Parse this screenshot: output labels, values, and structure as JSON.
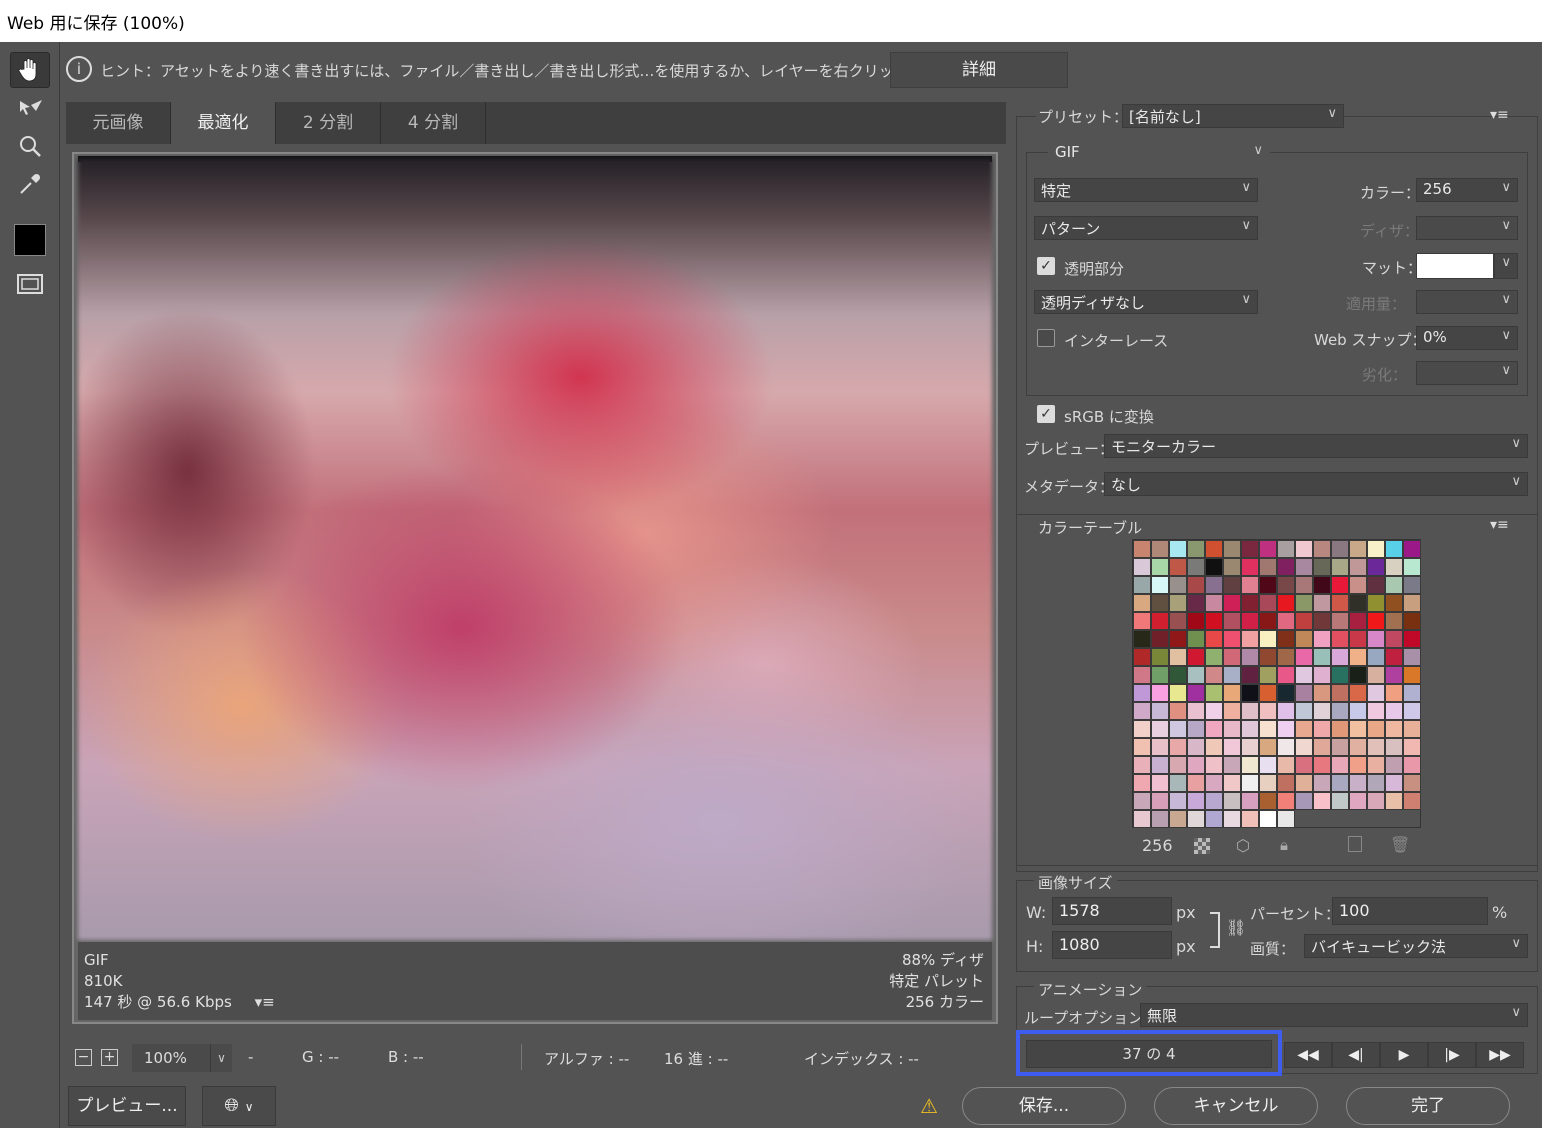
{
  "window": {
    "title": "Web 用に保存 (100%)"
  },
  "hint": {
    "text": "ヒント：アセットをより速く書き出すには、ファイル／書き出し／書き出し形式…を使用するか、レイヤーを右クリックして使用。",
    "detail_button": "詳細"
  },
  "tabs": [
    {
      "label": "元画像"
    },
    {
      "label": "最適化"
    },
    {
      "label": "2 分割"
    },
    {
      "label": "4 分割"
    }
  ],
  "image_info": {
    "format": "GIF",
    "size": "810K",
    "download_time": "147 秒 @ 56.6 Kbps",
    "dither": "88% ディザ",
    "palette": "特定 パレット",
    "colors": "256 カラー"
  },
  "statusbar": {
    "zoom": "100%",
    "r": "-",
    "g": "G : --",
    "b": "B : --",
    "alpha": "アルファ : --",
    "hex": "16 進 : --",
    "index": "インデックス : --"
  },
  "preset": {
    "label": "プリセット：",
    "value": "[名前なし]",
    "format": "GIF",
    "reduction": "特定",
    "dither_algo": "パターン",
    "colors_label": "カラー：",
    "colors_value": "256",
    "dither_label": "ディザ：",
    "transparency_label": "透明部分",
    "matte_label": "マット：",
    "transparency_dither": "透明ディザなし",
    "amount_label": "適用量：",
    "interlace_label": "インターレース",
    "websnap_label": "Web スナップ：",
    "websnap_value": "0%",
    "lossy_label": "劣化：",
    "srgb_label": "sRGB に変換",
    "preview_label": "プレビュー：",
    "preview_value": "モニターカラー",
    "metadata_label": "メタデータ：",
    "metadata_value": "なし"
  },
  "color_table": {
    "title": "カラーテーブル",
    "count": "256",
    "swatches": [
      "#c98470",
      "#b08878",
      "#a8e8f0",
      "#8a9870",
      "#d05030",
      "#9a8870",
      "#7a2840",
      "#c03080",
      "#a8a0a0",
      "#f0c8d0",
      "#b88880",
      "#8a7880",
      "#c8a888",
      "#f8f0c8",
      "#58d0e8",
      "#9a1888",
      "#d8c8d8",
      "#a8d8a8",
      "#c05848",
      "#7a7a78",
      "#101010",
      "#9a8870",
      "#e03060",
      "#a07870",
      "#802060",
      "#a888a0",
      "#686858",
      "#a8a888",
      "#c09898",
      "#6a2898",
      "#d8d0c0",
      "#b8e8d0",
      "#98a8a8",
      "#d8f8f8",
      "#98908c",
      "#a84848",
      "#887090",
      "#604040",
      "#e08090",
      "#500818",
      "#784848",
      "#a87878",
      "#400818",
      "#e81838",
      "#c89088",
      "#603040",
      "#a8c8b0",
      "#7a7a88",
      "#d8a880",
      "#605040",
      "#a8a078",
      "#682848",
      "#c888a0",
      "#d02058",
      "#802030",
      "#a84858",
      "#e81820",
      "#8a9868",
      "#c098a0",
      "#d05848",
      "#303028",
      "#909030",
      "#905020",
      "#c8a080",
      "#f07878",
      "#d02030",
      "#985050",
      "#a00818",
      "#d01020",
      "#b05060",
      "#d02048",
      "#881818",
      "#e06880",
      "#c04040",
      "#703838",
      "#b87878",
      "#a82040",
      "#f01818",
      "#a07050",
      "#783010",
      "#282818",
      "#702028",
      "#901818",
      "#709050",
      "#e84848",
      "#f05070",
      "#f0a0a0",
      "#f8f0c0",
      "#803018",
      "#c08858",
      "#f0a0c0",
      "#e05060",
      "#c83848",
      "#d888c8",
      "#c04860",
      "#c00828",
      "#b02828",
      "#788838",
      "#e0c0a0",
      "#d01830",
      "#90b070",
      "#d06878",
      "#b088a8",
      "#904830",
      "#a06848",
      "#e868a8",
      "#98c0b8",
      "#d8a8d8",
      "#f0b088",
      "#98a8c0",
      "#c02040",
      "#a890a8",
      "#d07888",
      "#70a068",
      "#305838",
      "#a8c0c0",
      "#d08888",
      "#a8b0c8",
      "#602040",
      "#a0a060",
      "#e85888",
      "#e0c8e0",
      "#e0b0d0",
      "#287060",
      "#182018",
      "#d8b0a0",
      "#b040a0",
      "#d87828",
      "#c098d8",
      "#f8a0e0",
      "#e8e890",
      "#a030a0",
      "#a8c070",
      "#e8a878",
      "#101018",
      "#d86030",
      "#182830",
      "#a880a0",
      "#d89880",
      "#c07060",
      "#d86848",
      "#e0c8e0",
      "#f0a080",
      "#b0b0d0",
      "#d0a8c8",
      "#c8b8d8",
      "#e09080",
      "#e8c0d0",
      "#f0d0e8",
      "#f0b0a0",
      "#e0c0c8",
      "#f0c0c0",
      "#e0c0e8",
      "#c0c8d8",
      "#e0d0d8",
      "#a8a8c0",
      "#c8c8e8",
      "#f0c8e0",
      "#e8c8e8",
      "#d0c8e8",
      "#f0d0c8",
      "#e8d0e0",
      "#d0c8e0",
      "#b8a8c8",
      "#f0a8c0",
      "#e8b8c8",
      "#e0c8d8",
      "#f8e0d0",
      "#f0d0f0",
      "#e8a890",
      "#f0a8a8",
      "#e09878",
      "#f0c0a0",
      "#e8a888",
      "#f0b8a0",
      "#e8b098",
      "#f0c0b0",
      "#e8c0c8",
      "#e8a8a8",
      "#d8b8c8",
      "#f0c8b8",
      "#f0c8d8",
      "#e8d0d0",
      "#d8a880",
      "#f0e8e8",
      "#f0d8d0",
      "#e0a898",
      "#c8a0a0",
      "#e0b0a0",
      "#e0c0b8",
      "#d8c0c0",
      "#f0b8b0",
      "#e8b0b8",
      "#c8b0d0",
      "#d8a8b0",
      "#e0a8c0",
      "#f0c0c8",
      "#c8a8b8",
      "#f0e8d0",
      "#e8e0f0",
      "#e8b8a8",
      "#d87080",
      "#e87880",
      "#e8a8b8",
      "#f0a088",
      "#e8b0a0",
      "#c0a0b0",
      "#e898a8",
      "#f0a8b0",
      "#f0c0d0",
      "#a8b8b8",
      "#e8a0a0",
      "#d8a8c0",
      "#f0c8c8",
      "#f0f0f0",
      "#e8d0c0",
      "#c07060",
      "#e0b098",
      "#c8a8b8",
      "#a8a8c0",
      "#c8b0c8",
      "#b0a8b8",
      "#d8b8d8",
      "#c89080",
      "#c8a8b8",
      "#d8a0b8",
      "#c8b8d8",
      "#c8a8d8",
      "#b8a8d0",
      "#c8c0c0",
      "#d8a0c0",
      "#a86030",
      "#f08078",
      "#a898b8",
      "#f8c0c8",
      "#c0c8c8",
      "#e0a8c0",
      "#d8a8b8",
      "#e8c0a8",
      "#d08070",
      "#e8c8d0",
      "#b8a0b0",
      "#c8a890",
      "#e0d8d8",
      "#b0a8d0",
      "#e8d8e0",
      "#f0c0b8",
      "#ffffff",
      "#e8e8e8"
    ]
  },
  "image_size": {
    "title": "画像サイズ",
    "w_label": "W:",
    "w_value": "1578",
    "h_label": "H:",
    "h_value": "1080",
    "px": "px",
    "percent_label": "パーセント：",
    "percent_value": "100",
    "percent_unit": "%",
    "quality_label": "画質：",
    "quality_value": "バイキュービック法"
  },
  "animation": {
    "title": "アニメーション",
    "loop_label": "ループオプション：",
    "loop_value": "無限",
    "frame_counter": "37 の 4"
  },
  "footer": {
    "preview_button": "プレビュー...",
    "save_button": "保存...",
    "cancel_button": "キャンセル",
    "done_button": "完了"
  }
}
